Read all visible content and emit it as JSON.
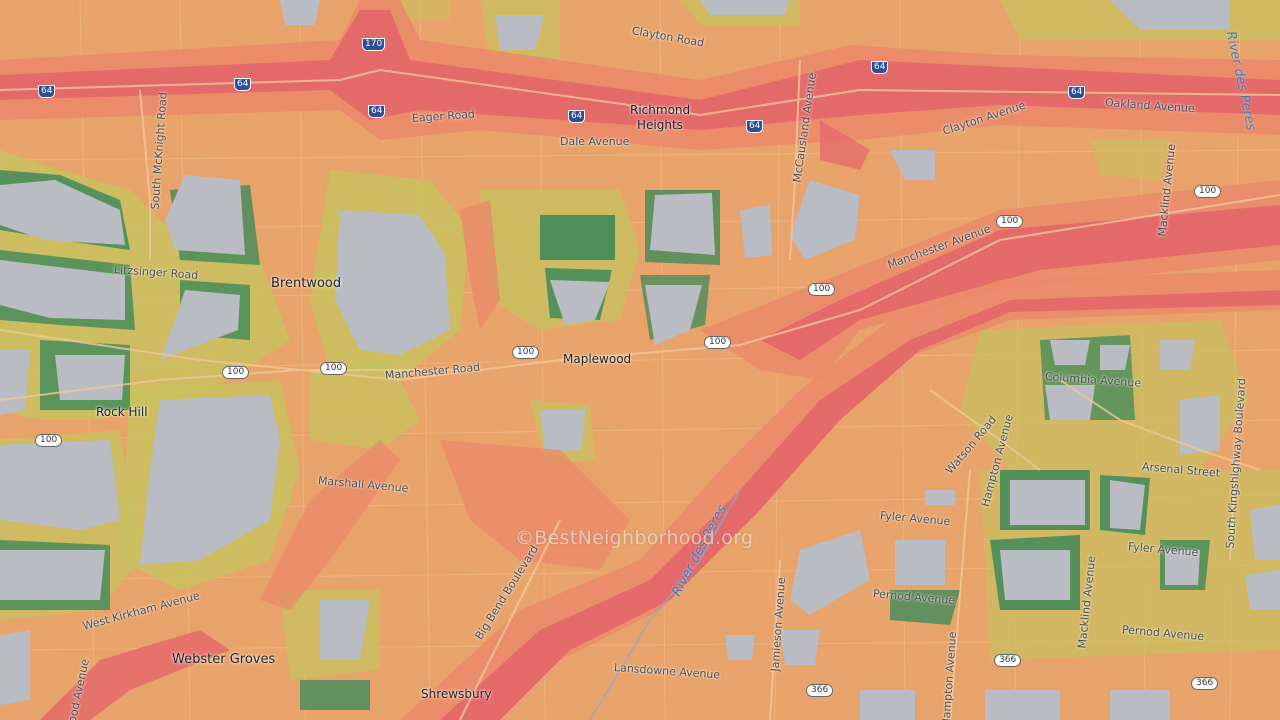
{
  "map": {
    "watermark": "©BestNeighborhood.org",
    "colors": {
      "base": "#e8a36a",
      "high": "#e46a6a",
      "medium_high": "#ea8a6a",
      "low": "#c5c25e",
      "lowest": "#3f8a5a",
      "no_data": "#b9bcc2",
      "street": "#f0c08e"
    },
    "places": {
      "richmond_heights_1": "Richmond",
      "richmond_heights_2": "Heights",
      "brentwood": "Brentwood",
      "maplewood": "Maplewood",
      "rock_hill": "Rock Hill",
      "webster_groves": "Webster Groves",
      "shrewsbury": "Shrewsbury"
    },
    "streets": {
      "clayton_road": "Clayton Road",
      "eager_road": "Eager Road",
      "dale_avenue": "Dale Avenue",
      "mccausland": "McCausland Avenue",
      "clayton_avenue": "Clayton Avenue",
      "oakland": "Oakland Avenue",
      "mackind_top": "Macklind Avenue",
      "south_mcknight": "South McKnight Road",
      "litzsinger": "Litzsinger Road",
      "manchester_ave": "Manchester Avenue",
      "manchester_road": "Manchester Road",
      "marshall": "Marshall Avenue",
      "west_kirkham": "West Kirkham Avenue",
      "big_bend": "Big Bend Boulevard",
      "lansdowne": "Lansdowne Avenue",
      "jamieson": "Jamieson Avenue",
      "hampton_1": "Hampton Avenue",
      "hampton_2": "Hampton Avenue",
      "watson": "Watson Road",
      "columbia": "Columbia Avenue",
      "arsenal": "Arsenal Street",
      "south_kingshighway": "South Kingshighway Boulevard",
      "fyler_1": "Fyler Avenue",
      "fyler_2": "Fyler Avenue",
      "pernod_1": "Pernod Avenue",
      "pernod_2": "Pernod Avenue",
      "macklind_bottom": "Macklind Avenue",
      "wood_ave": "ood Avenue"
    },
    "rivers": {
      "river_des_peres_top": "River des Peres",
      "river_des_peres_mid": "River des Peres"
    },
    "shields": {
      "i170": "170",
      "i64_a": "64",
      "i64_b": "64",
      "i64_c": "64",
      "i64_d": "64",
      "i64_e": "64",
      "i64_f": "64",
      "us100_a": "100",
      "us100_b": "100",
      "us100_c": "100",
      "us100_d": "100",
      "us100_e": "100",
      "us100_f": "100",
      "us100_g": "100",
      "us100_h": "100",
      "r366_a": "366",
      "r366_b": "366",
      "r366_c": "366"
    }
  }
}
